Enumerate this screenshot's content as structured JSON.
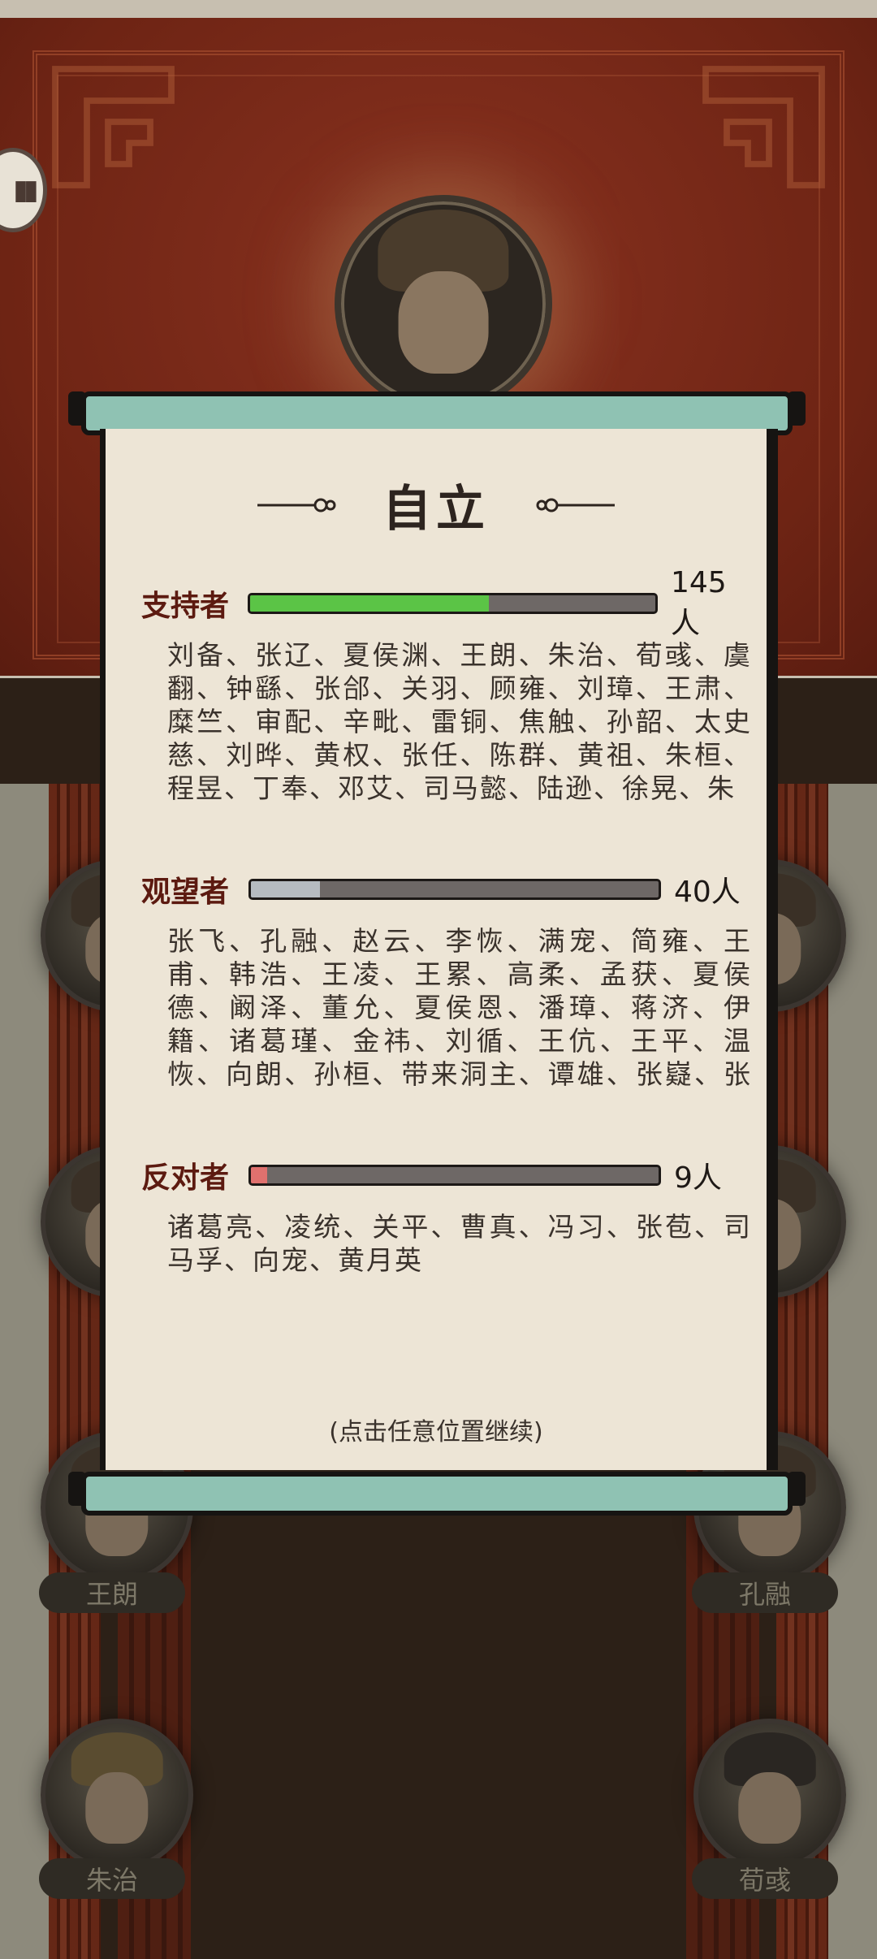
{
  "event_title": "自立",
  "sections": [
    {
      "label": "支持者",
      "count": "145人",
      "fraction": 0.59,
      "color": "#5bc446",
      "names": "刘备、张辽、夏侯渊、王朗、朱治、荀彧、虞翻、钟繇、张郃、关羽、顾雍、刘璋、王肃、糜竺、审配、辛毗、雷铜、焦触、孙韶、太史慈、刘晔、黄权、张任、陈群、黄祖、朱桓、程昱、丁奉、邓艾、司马懿、陆逊、徐晃、朱"
    },
    {
      "label": "观望者",
      "count": "40人",
      "fraction": 0.17,
      "color": "#b6bbc0",
      "names": "张飞、孔融、赵云、李恢、满宠、简雍、王甫、韩浩、王凌、王累、高柔、孟获、夏侯德、阚泽、董允、夏侯恩、潘璋、蒋济、伊籍、诸葛瑾、金祎、刘循、王伉、王平、温恢、向朗、孙桓、带来洞主、谭雄、张嶷、张翼、夏侯"
    },
    {
      "label": "反对者",
      "count": "9人",
      "fraction": 0.04,
      "color": "#e0716e",
      "names": "诸葛亮、凌统、关平、曹真、冯习、张苞、司马孚、向宠、黄月英"
    }
  ],
  "hint": "(点击任意位置继续)",
  "background_name_plates": [
    "王朗",
    "孔融",
    "朱治",
    "荀彧"
  ],
  "icons": {
    "side_bubble": "chat-bubble-icon",
    "title_ornament": "ornament-icon"
  }
}
